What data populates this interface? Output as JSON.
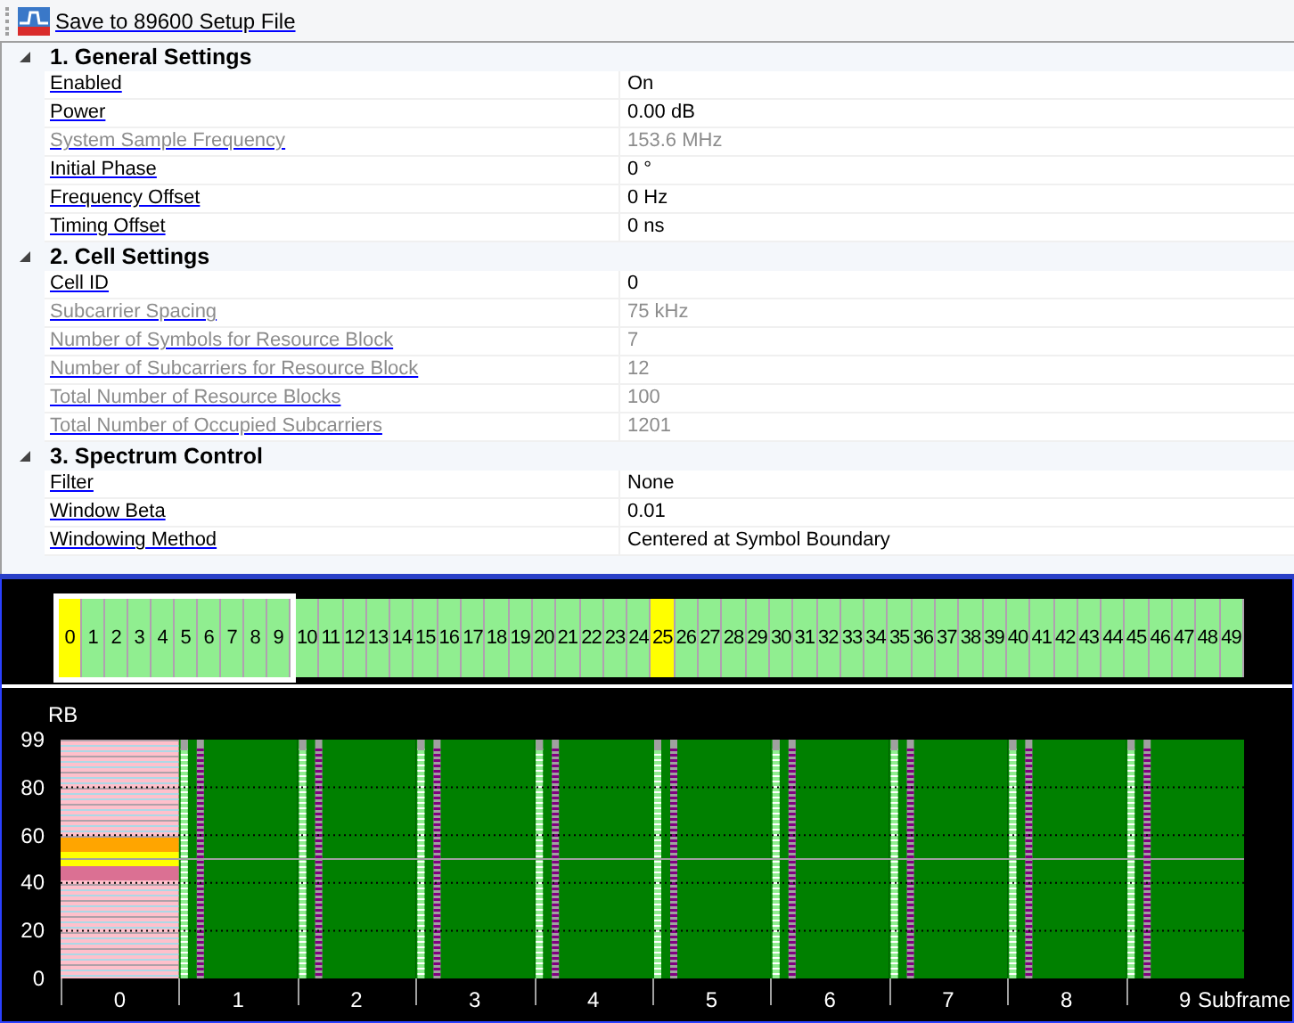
{
  "toolbar": {
    "save_link": "Save to 89600 Setup File"
  },
  "property_grid": {
    "groups": [
      {
        "title": "1. General Settings",
        "expanded": true,
        "properties": [
          {
            "name": "Enabled",
            "value": "On",
            "disabled": false
          },
          {
            "name": "Power",
            "value": "0.00 dB",
            "disabled": false
          },
          {
            "name": "System Sample Frequency",
            "value": "153.6 MHz",
            "disabled": true
          },
          {
            "name": "Initial Phase",
            "value": "0 °",
            "disabled": false
          },
          {
            "name": "Frequency Offset",
            "value": "0 Hz",
            "disabled": false
          },
          {
            "name": "Timing Offset",
            "value": "0 ns",
            "disabled": false
          }
        ]
      },
      {
        "title": "2. Cell Settings",
        "expanded": true,
        "properties": [
          {
            "name": "Cell ID",
            "value": "0",
            "disabled": false
          },
          {
            "name": "Subcarrier Spacing",
            "value": "75 kHz",
            "disabled": true
          },
          {
            "name": "Number of Symbols for Resource Block",
            "value": "7",
            "disabled": true
          },
          {
            "name": "Number of Subcarriers for Resource Block",
            "value": "12",
            "disabled": true
          },
          {
            "name": "Total Number of Resource Blocks",
            "value": "100",
            "disabled": true
          },
          {
            "name": "Total Number of Occupied Subcarriers",
            "value": "1201",
            "disabled": true
          }
        ]
      },
      {
        "title": "3. Spectrum Control",
        "expanded": true,
        "properties": [
          {
            "name": "Filter",
            "value": "None",
            "disabled": false
          },
          {
            "name": "Window Beta",
            "value": "0.01",
            "disabled": false
          },
          {
            "name": "Windowing Method",
            "value": "Centered at Symbol Boundary",
            "disabled": false
          }
        ]
      }
    ]
  },
  "slot_strip": {
    "slots": [
      {
        "label": "0",
        "highlighted": true
      },
      {
        "label": "1",
        "highlighted": false
      },
      {
        "label": "2",
        "highlighted": false
      },
      {
        "label": "3",
        "highlighted": false
      },
      {
        "label": "4",
        "highlighted": false
      },
      {
        "label": "5",
        "highlighted": false
      },
      {
        "label": "6",
        "highlighted": false
      },
      {
        "label": "7",
        "highlighted": false
      },
      {
        "label": "8",
        "highlighted": false
      },
      {
        "label": "9",
        "highlighted": false
      },
      {
        "label": "10",
        "highlighted": false
      },
      {
        "label": "11",
        "highlighted": false
      },
      {
        "label": "12",
        "highlighted": false
      },
      {
        "label": "13",
        "highlighted": false
      },
      {
        "label": "14",
        "highlighted": false
      },
      {
        "label": "15",
        "highlighted": false
      },
      {
        "label": "16",
        "highlighted": false
      },
      {
        "label": "17",
        "highlighted": false
      },
      {
        "label": "18",
        "highlighted": false
      },
      {
        "label": "19",
        "highlighted": false
      },
      {
        "label": "20",
        "highlighted": false
      },
      {
        "label": "21",
        "highlighted": false
      },
      {
        "label": "22",
        "highlighted": false
      },
      {
        "label": "23",
        "highlighted": false
      },
      {
        "label": "24",
        "highlighted": false
      },
      {
        "label": "25",
        "highlighted": true
      },
      {
        "label": "26",
        "highlighted": false
      },
      {
        "label": "27",
        "highlighted": false
      },
      {
        "label": "28",
        "highlighted": false
      },
      {
        "label": "29",
        "highlighted": false
      },
      {
        "label": "30",
        "highlighted": false
      },
      {
        "label": "31",
        "highlighted": false
      },
      {
        "label": "32",
        "highlighted": false
      },
      {
        "label": "33",
        "highlighted": false
      },
      {
        "label": "34",
        "highlighted": false
      },
      {
        "label": "35",
        "highlighted": false
      },
      {
        "label": "36",
        "highlighted": false
      },
      {
        "label": "37",
        "highlighted": false
      },
      {
        "label": "38",
        "highlighted": false
      },
      {
        "label": "39",
        "highlighted": false
      },
      {
        "label": "40",
        "highlighted": false
      },
      {
        "label": "41",
        "highlighted": false
      },
      {
        "label": "42",
        "highlighted": false
      },
      {
        "label": "43",
        "highlighted": false
      },
      {
        "label": "44",
        "highlighted": false
      },
      {
        "label": "45",
        "highlighted": false
      },
      {
        "label": "46",
        "highlighted": false
      },
      {
        "label": "47",
        "highlighted": false
      },
      {
        "label": "48",
        "highlighted": false
      },
      {
        "label": "49",
        "highlighted": false
      }
    ]
  },
  "resource_map": {
    "y_title": "RB",
    "x_title": "Subframe",
    "y_ticks": [
      "99",
      "80",
      "60",
      "40",
      "20",
      "0"
    ],
    "x_labels": [
      "0",
      "1",
      "2",
      "3",
      "4",
      "5",
      "6",
      "7",
      "8",
      "9"
    ]
  }
}
